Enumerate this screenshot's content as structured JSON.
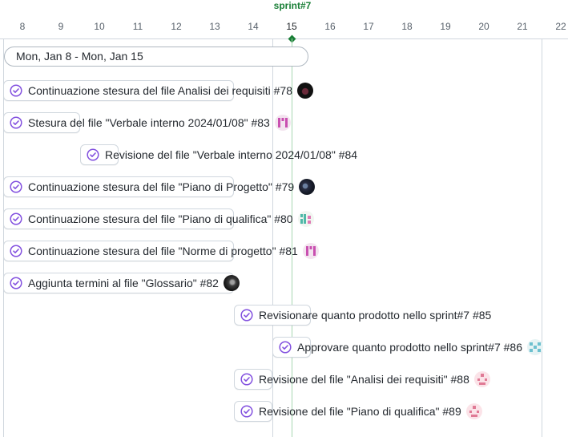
{
  "timeline": {
    "sprint_label": "sprint#7",
    "days": [
      "8",
      "9",
      "10",
      "11",
      "12",
      "13",
      "14",
      "15",
      "16",
      "17",
      "18",
      "19",
      "20",
      "21",
      "22"
    ],
    "date_range": "Mon, Jan 8 - Mon, Jan 15"
  },
  "issues": [
    {
      "title": "Continuazione stesura del file Analisi dei requisiti #78",
      "avatar": "dark-avatar"
    },
    {
      "title": "Stesura del file \"Verbale interno 2024/01/08\" #83",
      "avatar": "pink-identicon"
    },
    {
      "title": "Revisione del file \"Verbale interno 2024/01/08\" #84",
      "avatar": ""
    },
    {
      "title": "Continuazione stesura del file \"Piano di Progetto\" #79",
      "avatar": "dark-avatar"
    },
    {
      "title": "Continuazione stesura del file \"Piano di qualifica\" #80",
      "avatar": "multicolor-identicon"
    },
    {
      "title": "Continuazione stesura del file \"Norme di progetto\" #81",
      "avatar": "pink-identicon"
    },
    {
      "title": "Aggiunta termini al file \"Glossario\" #82",
      "avatar": "dark-avatar"
    },
    {
      "title": "Revisionare quanto prodotto nello sprint#7 #85",
      "avatar": ""
    },
    {
      "title": "Approvare quanto prodotto nello sprint#7 #86",
      "avatar": "teal-identicon"
    },
    {
      "title": "Revisione del file \"Analisi dei requisiti\" #88",
      "avatar": "pink-identicon"
    },
    {
      "title": "Revisione del file \"Piano di qualifica\" #89",
      "avatar": "pink-identicon"
    }
  ],
  "colors": {
    "accent": "#8250df",
    "today": "#1a7f37",
    "grid": "#d0d7de"
  }
}
